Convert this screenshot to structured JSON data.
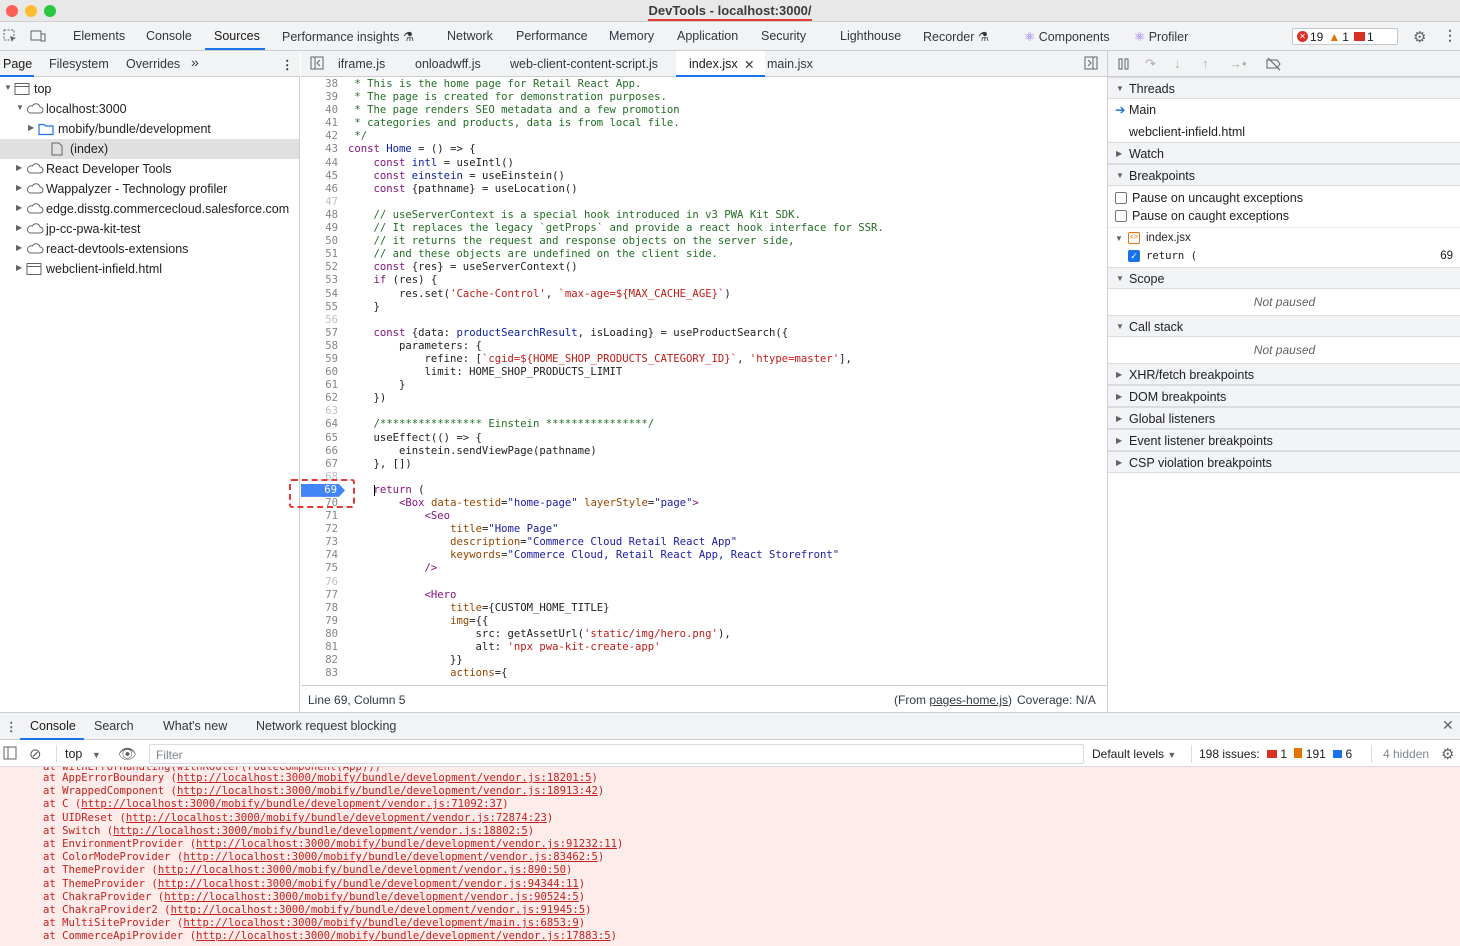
{
  "window": {
    "title": "DevTools - localhost:3000/"
  },
  "main_tabs": [
    "Elements",
    "Console",
    "Sources",
    "Performance insights",
    "Network",
    "Performance",
    "Memory",
    "Application",
    "Security",
    "Lighthouse",
    "Recorder",
    "Components",
    "Profiler"
  ],
  "counts": {
    "errors": "19",
    "warnings": "1",
    "issues": "1"
  },
  "navigator": {
    "tabs": [
      "Page",
      "Filesystem",
      "Overrides"
    ],
    "tree": [
      {
        "label": "top",
        "icon": "frame-icon",
        "depth": 0,
        "expanded": true
      },
      {
        "label": "localhost:3000",
        "icon": "cloud-icon",
        "depth": 1,
        "expanded": true
      },
      {
        "label": "mobify/bundle/development",
        "icon": "folder-icon",
        "depth": 2,
        "expanded": false
      },
      {
        "label": "(index)",
        "icon": "file-icon",
        "depth": 3,
        "expanded": null,
        "selected": true
      },
      {
        "label": "React Developer Tools",
        "icon": "cloud-icon",
        "depth": 1,
        "expanded": false
      },
      {
        "label": "Wappalyzer - Technology profiler",
        "icon": "cloud-icon",
        "depth": 1,
        "expanded": false
      },
      {
        "label": "edge.disstg.commercecloud.salesforce.com",
        "icon": "cloud-icon",
        "depth": 1,
        "expanded": false
      },
      {
        "label": "jp-cc-pwa-kit-test",
        "icon": "cloud-icon",
        "depth": 1,
        "expanded": false
      },
      {
        "label": "react-devtools-extensions",
        "icon": "cloud-icon",
        "depth": 1,
        "expanded": false
      },
      {
        "label": "webclient-infield.html",
        "icon": "frame-icon",
        "depth": 1,
        "expanded": false
      }
    ]
  },
  "editor": {
    "tabs": [
      "iframe.js",
      "onloadwff.js",
      "web-client-content-script.js",
      "index.jsx",
      "main.jsx"
    ],
    "active_tab": "index.jsx",
    "breakpoint_line": 69,
    "lines": [
      {
        "n": "38",
        "html": "<span class='c-cm'> * This is the home page for Retail React App.</span>"
      },
      {
        "n": "39",
        "html": "<span class='c-cm'> * The page is created for demonstration purposes.</span>"
      },
      {
        "n": "40",
        "html": "<span class='c-cm'> * The page renders SEO metadata and a few promotion</span>"
      },
      {
        "n": "41",
        "html": "<span class='c-cm'> * categories and products, data is from local file.</span>"
      },
      {
        "n": "42",
        "html": "<span class='c-cm'> */</span>"
      },
      {
        "n": "43",
        "html": "<span class='c-kw'>const</span> <span class='c-vr'>Home</span> = () => {"
      },
      {
        "n": "44",
        "html": "    <span class='c-kw'>const</span> <span class='c-vr'>intl</span> = useIntl()"
      },
      {
        "n": "45",
        "html": "    <span class='c-kw'>const</span> <span class='c-vr'>einstein</span> = useEinstein()"
      },
      {
        "n": "46",
        "html": "    <span class='c-kw'>const</span> {pathname} = useLocation()"
      },
      {
        "n": "47",
        "html": "",
        "dim": true
      },
      {
        "n": "48",
        "html": "    <span class='c-cm'>// useServerContext is a special hook introduced in v3 PWA Kit SDK.</span>"
      },
      {
        "n": "49",
        "html": "    <span class='c-cm'>// It replaces the legacy `getProps` and provide a react hook interface for SSR.</span>"
      },
      {
        "n": "50",
        "html": "    <span class='c-cm'>// it returns the request and response objects on the server side,</span>"
      },
      {
        "n": "51",
        "html": "    <span class='c-cm'>// and these objects are undefined on the client side.</span>"
      },
      {
        "n": "52",
        "html": "    <span class='c-kw'>const</span> {res} = useServerContext()"
      },
      {
        "n": "53",
        "html": "    <span class='c-kw'>if</span> (res) {"
      },
      {
        "n": "54",
        "html": "        res.set(<span class='c-str'>'Cache-Control'</span>, <span class='c-str'>`max-age=${MAX_CACHE_AGE}`</span>)"
      },
      {
        "n": "55",
        "html": "    }"
      },
      {
        "n": "56",
        "html": "",
        "dim": true
      },
      {
        "n": "57",
        "html": "    <span class='c-kw'>const</span> {data: <span class='c-vr'>productSearchResult</span>, isLoading} = useProductSearch({"
      },
      {
        "n": "58",
        "html": "        parameters: {"
      },
      {
        "n": "59",
        "html": "            refine: [<span class='c-str'>`cgid=${HOME_SHOP_PRODUCTS_CATEGORY_ID}`</span>, <span class='c-str'>'htype=master'</span>],"
      },
      {
        "n": "60",
        "html": "            limit: HOME_SHOP_PRODUCTS_LIMIT"
      },
      {
        "n": "61",
        "html": "        }"
      },
      {
        "n": "62",
        "html": "    })"
      },
      {
        "n": "63",
        "html": "",
        "dim": true
      },
      {
        "n": "64",
        "html": "    <span class='c-cm'>/**************** Einstein ****************/</span>"
      },
      {
        "n": "65",
        "html": "    useEffect(() => {"
      },
      {
        "n": "66",
        "html": "        einstein.sendViewPage(pathname)"
      },
      {
        "n": "67",
        "html": "    }, [])"
      },
      {
        "n": "68",
        "html": "",
        "dim": true
      },
      {
        "n": "69",
        "html": "    <span class='c-kw'>return</span> (",
        "bp": true
      },
      {
        "n": "70",
        "html": "        <span class='c-tg'>&lt;Box</span> <span class='c-ab'>data-testid</span>=<span class='c-av'>\"home-page\"</span> <span class='c-ab'>layerStyle</span>=<span class='c-av'>\"page\"</span><span class='c-tg'>&gt;</span>"
      },
      {
        "n": "71",
        "html": "            <span class='c-tg'>&lt;Seo</span>"
      },
      {
        "n": "72",
        "html": "                <span class='c-ab'>title</span>=<span class='c-av'>\"Home Page\"</span>"
      },
      {
        "n": "73",
        "html": "                <span class='c-ab'>description</span>=<span class='c-av'>\"Commerce Cloud Retail React App\"</span>"
      },
      {
        "n": "74",
        "html": "                <span class='c-ab'>keywords</span>=<span class='c-av'>\"Commerce Cloud, Retail React App, React Storefront\"</span>"
      },
      {
        "n": "75",
        "html": "            <span class='c-tg'>/&gt;</span>"
      },
      {
        "n": "76",
        "html": "",
        "dim": true
      },
      {
        "n": "77",
        "html": "            <span class='c-tg'>&lt;Hero</span>"
      },
      {
        "n": "78",
        "html": "                <span class='c-ab'>title</span>={CUSTOM_HOME_TITLE}"
      },
      {
        "n": "79",
        "html": "                <span class='c-ab'>img</span>={{"
      },
      {
        "n": "80",
        "html": "                    src: getAssetUrl(<span class='c-str'>'static/img/hero.png'</span>),"
      },
      {
        "n": "81",
        "html": "                    alt: <span class='c-str'>'npx pwa-kit-create-app'</span>"
      },
      {
        "n": "82",
        "html": "                }}"
      },
      {
        "n": "83",
        "html": "                <span class='c-ab'>actions</span>={"
      }
    ],
    "status_left": "Line 69, Column 5",
    "status_from_prefix": "(From ",
    "status_from_link": "pages-home.js",
    "status_from_suffix": ")",
    "status_coverage": "Coverage: N/A"
  },
  "debugger": {
    "threads_label": "Threads",
    "thread_main": "Main",
    "thread_other": "webclient-infield.html",
    "watch_label": "Watch",
    "breakpoints_label": "Breakpoints",
    "pause_uncaught": "Pause on uncaught exceptions",
    "pause_caught": "Pause on caught exceptions",
    "bp_file": "index.jsx",
    "bp_code": "return (",
    "bp_line": "69",
    "scope_label": "Scope",
    "not_paused": "Not paused",
    "callstack_label": "Call stack",
    "collapsed": [
      "XHR/fetch breakpoints",
      "DOM breakpoints",
      "Global listeners",
      "Event listener breakpoints",
      "CSP violation breakpoints"
    ]
  },
  "drawer": {
    "tabs": [
      "Console",
      "Search",
      "What's new",
      "Network request blocking"
    ],
    "context": "top",
    "filter_placeholder": "Filter",
    "levels": "Default levels",
    "issues_label": "198 issues:",
    "issues_err": "1",
    "issues_warn": "191",
    "issues_info": "6",
    "hidden": "4 hidden",
    "error_lines": [
      {
        "pre": "at withErrorHandling(withRouter(routeComponent(App)))",
        "url": "",
        "post": ""
      },
      {
        "pre": "at AppErrorBoundary (",
        "url": "http://localhost:3000/mobify/bundle/development/vendor.js:18201:5",
        "post": ")"
      },
      {
        "pre": "at WrappedComponent (",
        "url": "http://localhost:3000/mobify/bundle/development/vendor.js:18913:42",
        "post": ")"
      },
      {
        "pre": "at C (",
        "url": "http://localhost:3000/mobify/bundle/development/vendor.js:71092:37",
        "post": ")"
      },
      {
        "pre": "at UIDReset (",
        "url": "http://localhost:3000/mobify/bundle/development/vendor.js:72874:23",
        "post": ")"
      },
      {
        "pre": "at Switch (",
        "url": "http://localhost:3000/mobify/bundle/development/vendor.js:18802:5",
        "post": ")"
      },
      {
        "pre": "at EnvironmentProvider (",
        "url": "http://localhost:3000/mobify/bundle/development/vendor.js:91232:11",
        "post": ")"
      },
      {
        "pre": "at ColorModeProvider (",
        "url": "http://localhost:3000/mobify/bundle/development/vendor.js:83462:5",
        "post": ")"
      },
      {
        "pre": "at ThemeProvider (",
        "url": "http://localhost:3000/mobify/bundle/development/vendor.js:890:50",
        "post": ")"
      },
      {
        "pre": "at ThemeProvider (",
        "url": "http://localhost:3000/mobify/bundle/development/vendor.js:94344:11",
        "post": ")"
      },
      {
        "pre": "at ChakraProvider (",
        "url": "http://localhost:3000/mobify/bundle/development/vendor.js:90524:5",
        "post": ")"
      },
      {
        "pre": "at ChakraProvider2 (",
        "url": "http://localhost:3000/mobify/bundle/development/vendor.js:91945:5",
        "post": ")"
      },
      {
        "pre": "at MultiSiteProvider (",
        "url": "http://localhost:3000/mobify/bundle/development/main.js:6853:9",
        "post": ")"
      },
      {
        "pre": "at CommerceApiProvider (",
        "url": "http://localhost:3000/mobify/bundle/development/vendor.js:17883:5",
        "post": ")"
      }
    ]
  }
}
